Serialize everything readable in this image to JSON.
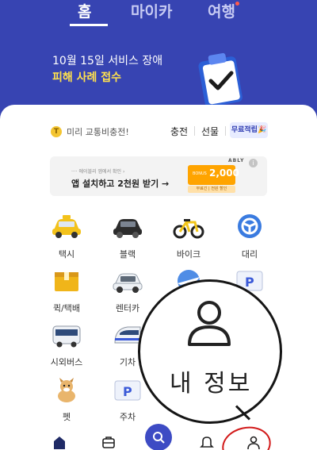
{
  "header": {
    "tabs": [
      {
        "label": "홈"
      },
      {
        "label": "마이카"
      },
      {
        "label": "여행"
      }
    ],
    "notice": {
      "line1": "10월 15일 서비스 장애",
      "line2": "피해 사례 접수"
    }
  },
  "prepay": {
    "coin_glyph": "T",
    "text": "미리 교통비충전!",
    "charge_label": "충전",
    "gift_label": "선물",
    "free_badge": "무료적립🎉"
  },
  "ad": {
    "small_text": "···· 에이블리 앱에서 확인 ›",
    "main_text": "앱 설치하고 2천원 받기 →",
    "brand": "ABLY",
    "info_glyph": "i",
    "bonus_label": "BONUS",
    "bonus_amount": "2,000",
    "bonus_sub": "무료긴 | 전원 할인"
  },
  "services": [
    {
      "label": "택시",
      "icon": "taxi-icon"
    },
    {
      "label": "블랙",
      "icon": "black-car-icon"
    },
    {
      "label": "바이크",
      "icon": "bike-icon"
    },
    {
      "label": "대리",
      "icon": "designated-driver-icon"
    },
    {
      "label": "퀵/택배",
      "icon": "parcel-icon"
    },
    {
      "label": "렌터카",
      "icon": "rental-car-icon"
    },
    {
      "label": "",
      "icon": "airplane-icon"
    },
    {
      "label": "",
      "icon": "parking-icon"
    },
    {
      "label": "시외버스",
      "icon": "bus-icon"
    },
    {
      "label": "기차",
      "icon": "train-icon"
    },
    {
      "label": "펫",
      "icon": "pet-icon"
    },
    {
      "label": "주차",
      "icon": "parking-icon"
    }
  ],
  "magnifier": {
    "label": "내 정보"
  },
  "bottom_nav": [
    {
      "icon": "home-icon"
    },
    {
      "icon": "briefcase-icon"
    },
    {
      "icon": "search-icon"
    },
    {
      "icon": "bell-icon"
    },
    {
      "icon": "profile-icon"
    }
  ],
  "colors": {
    "brand": "#3744b2",
    "accent_yellow": "#ffe14d",
    "highlight_red": "#d21a1a"
  }
}
